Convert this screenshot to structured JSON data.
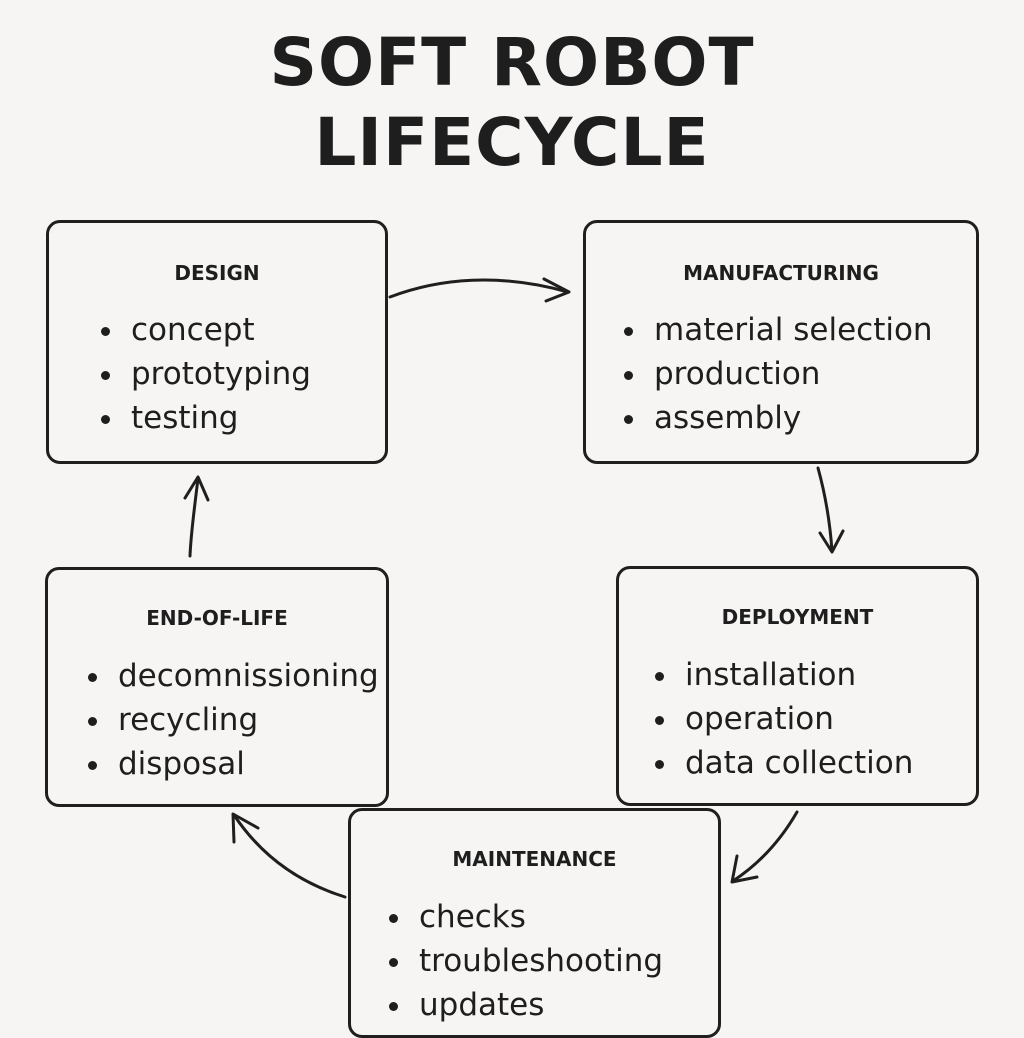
{
  "title": {
    "line1": "SOFT ROBOT",
    "line2": "LIFECYCLE"
  },
  "stages": {
    "design": {
      "title": "DESIGN",
      "items": [
        "concept",
        "prototyping",
        "testing"
      ]
    },
    "manufacturing": {
      "title": "MANUFACTURING",
      "items": [
        "material selection",
        "production",
        "assembly"
      ]
    },
    "deployment": {
      "title": "DEPLOYMENT",
      "items": [
        "installation",
        "operation",
        "data collection"
      ]
    },
    "maintenance": {
      "title": "MAINTENANCE",
      "items": [
        "checks",
        "troubleshooting",
        "updates"
      ]
    },
    "end_of_life": {
      "title": "END-OF-LIFE",
      "items": [
        "decomnissioning",
        "recycling",
        "disposal"
      ]
    }
  },
  "flow": [
    {
      "from": "DESIGN",
      "to": "MANUFACTURING"
    },
    {
      "from": "MANUFACTURING",
      "to": "DEPLOYMENT"
    },
    {
      "from": "DEPLOYMENT",
      "to": "MAINTENANCE"
    },
    {
      "from": "MAINTENANCE",
      "to": "END-OF-LIFE"
    },
    {
      "from": "END-OF-LIFE",
      "to": "DESIGN"
    }
  ]
}
